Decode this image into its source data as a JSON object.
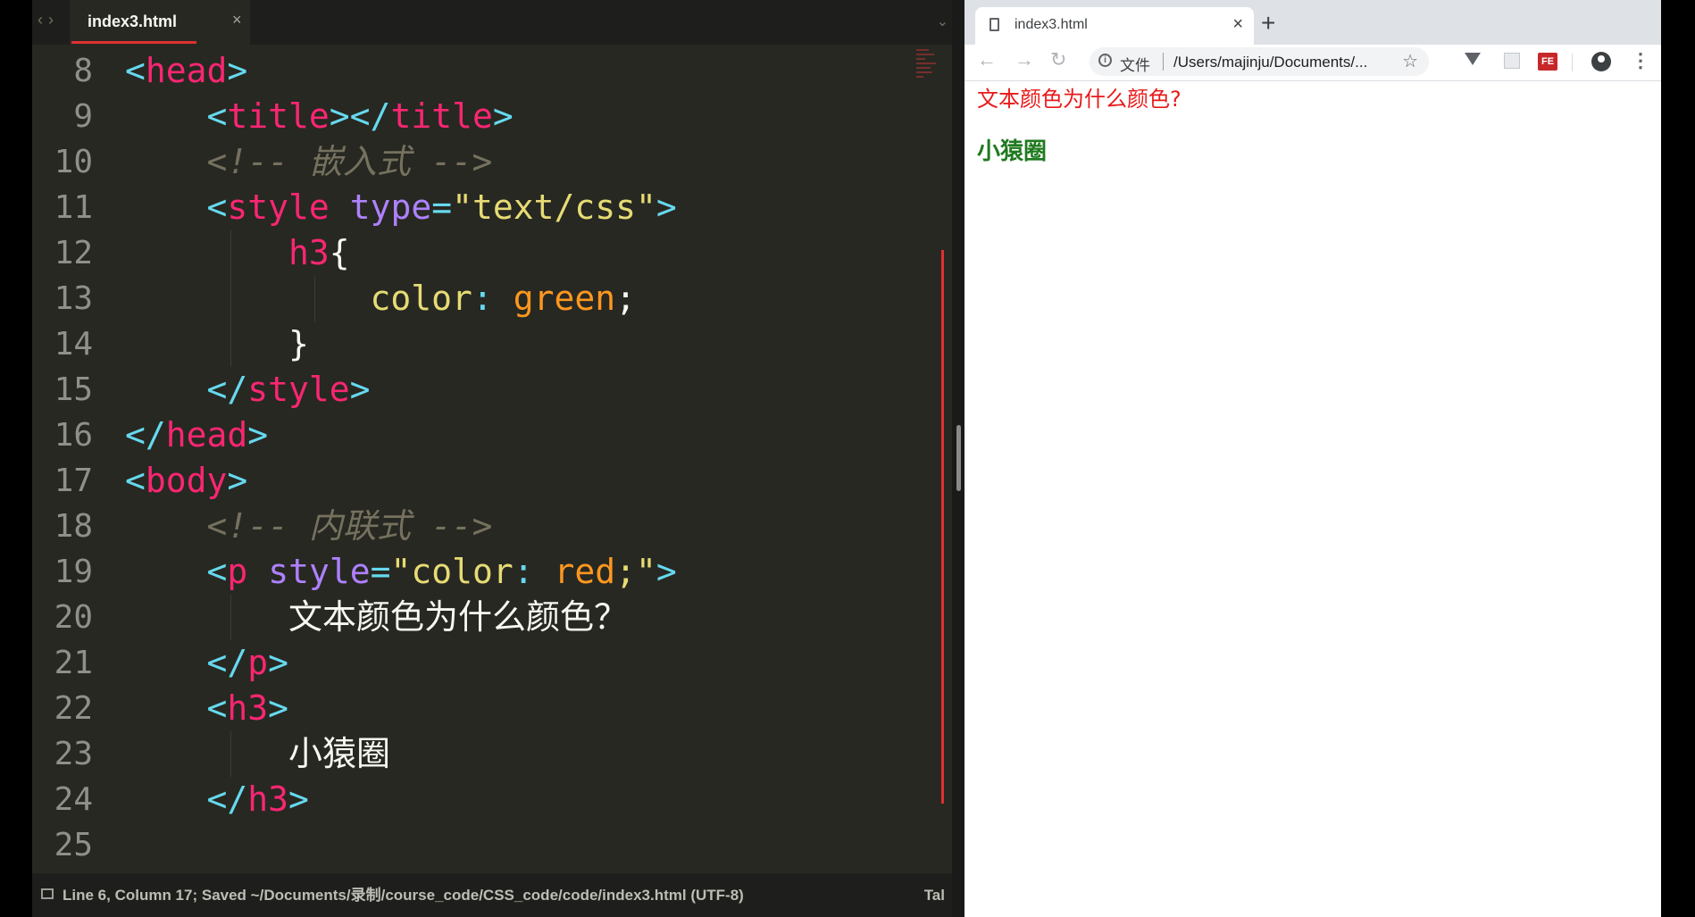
{
  "editor": {
    "tab_name": "index3.html",
    "tab_close": "×",
    "lines": [
      {
        "n": "8",
        "tokens": [
          {
            "c": "pun",
            "t": "<"
          },
          {
            "c": "tg",
            "t": "head"
          },
          {
            "c": "pun",
            "t": ">"
          }
        ]
      },
      {
        "n": "9",
        "tokens": [
          {
            "c": "pu",
            "t": "    "
          },
          {
            "c": "pun",
            "t": "<"
          },
          {
            "c": "tg",
            "t": "title"
          },
          {
            "c": "pun",
            "t": "></"
          },
          {
            "c": "tg",
            "t": "title"
          },
          {
            "c": "pun",
            "t": ">"
          }
        ]
      },
      {
        "n": "10",
        "tokens": [
          {
            "c": "pu",
            "t": "    "
          },
          {
            "c": "cm",
            "t": "<!-- 嵌入式 -->"
          }
        ]
      },
      {
        "n": "11",
        "tokens": [
          {
            "c": "pu",
            "t": "    "
          },
          {
            "c": "pun",
            "t": "<"
          },
          {
            "c": "tg",
            "t": "style"
          },
          {
            "c": "pu",
            "t": " "
          },
          {
            "c": "at",
            "t": "type"
          },
          {
            "c": "pun",
            "t": "="
          },
          {
            "c": "st",
            "t": "\"text/css\""
          },
          {
            "c": "pun",
            "t": ">"
          }
        ]
      },
      {
        "n": "12",
        "tokens": [
          {
            "c": "pu",
            "t": "        "
          },
          {
            "c": "tg",
            "t": "h3"
          },
          {
            "c": "pu",
            "t": "{"
          }
        ]
      },
      {
        "n": "13",
        "tokens": [
          {
            "c": "pu",
            "t": "            "
          },
          {
            "c": "pr",
            "t": "color"
          },
          {
            "c": "pun",
            "t": ": "
          },
          {
            "c": "vl",
            "t": "green"
          },
          {
            "c": "pu",
            "t": ";"
          }
        ]
      },
      {
        "n": "14",
        "tokens": [
          {
            "c": "pu",
            "t": "        "
          },
          {
            "c": "pu",
            "t": "}"
          }
        ]
      },
      {
        "n": "15",
        "tokens": [
          {
            "c": "pu",
            "t": "    "
          },
          {
            "c": "pun",
            "t": "</"
          },
          {
            "c": "tg",
            "t": "style"
          },
          {
            "c": "pun",
            "t": ">"
          }
        ]
      },
      {
        "n": "16",
        "tokens": [
          {
            "c": "pun",
            "t": "</"
          },
          {
            "c": "tg",
            "t": "head"
          },
          {
            "c": "pun",
            "t": ">"
          }
        ]
      },
      {
        "n": "17",
        "tokens": [
          {
            "c": "pun",
            "t": "<"
          },
          {
            "c": "tg",
            "t": "body"
          },
          {
            "c": "pun",
            "t": ">"
          }
        ]
      },
      {
        "n": "18",
        "tokens": [
          {
            "c": "pu",
            "t": "    "
          },
          {
            "c": "cm",
            "t": "<!-- 内联式 -->"
          }
        ]
      },
      {
        "n": "19",
        "tokens": [
          {
            "c": "pu",
            "t": "    "
          },
          {
            "c": "pun",
            "t": "<"
          },
          {
            "c": "tg",
            "t": "p"
          },
          {
            "c": "pu",
            "t": " "
          },
          {
            "c": "at",
            "t": "style"
          },
          {
            "c": "pun",
            "t": "="
          },
          {
            "c": "st",
            "t": "\"color"
          },
          {
            "c": "pun",
            "t": ": "
          },
          {
            "c": "vl",
            "t": "red"
          },
          {
            "c": "st",
            "t": ";\""
          },
          {
            "c": "pun",
            "t": ">"
          }
        ]
      },
      {
        "n": "20",
        "tokens": [
          {
            "c": "pu",
            "t": "        "
          },
          {
            "c": "tx",
            "t": "文本颜色为什么颜色？"
          }
        ]
      },
      {
        "n": "21",
        "tokens": [
          {
            "c": "pu",
            "t": "    "
          },
          {
            "c": "pun",
            "t": "</"
          },
          {
            "c": "tg",
            "t": "p"
          },
          {
            "c": "pun",
            "t": ">"
          }
        ]
      },
      {
        "n": "22",
        "tokens": [
          {
            "c": "pu",
            "t": "    "
          },
          {
            "c": "pun",
            "t": "<"
          },
          {
            "c": "tg",
            "t": "h3"
          },
          {
            "c": "pun",
            "t": ">"
          }
        ]
      },
      {
        "n": "23",
        "tokens": [
          {
            "c": "pu",
            "t": "        "
          },
          {
            "c": "tx",
            "t": "小猿圈"
          }
        ]
      },
      {
        "n": "24",
        "tokens": [
          {
            "c": "pu",
            "t": "    "
          },
          {
            "c": "pun",
            "t": "</"
          },
          {
            "c": "tg",
            "t": "h3"
          },
          {
            "c": "pun",
            "t": ">"
          }
        ]
      },
      {
        "n": "25",
        "tokens": []
      }
    ],
    "status_text": "Line 6, Column 17; Saved ~/Documents/录制/course_code/CSS_code/code/index3.html (UTF-8)",
    "status_right": "Tal"
  },
  "browser": {
    "tab_title": "index3.html",
    "tab_close": "×",
    "new_tab": "+",
    "back": "←",
    "forward": "→",
    "reload": "↻",
    "info": "i",
    "scheme": "文件",
    "url": "/Users/majinju/Documents/...",
    "star": "☆",
    "ext_fe": "FE",
    "menu": "⋮",
    "page_paragraph": "文本颜色为什么颜色?",
    "page_heading": "小猿圈"
  },
  "colors": {
    "paragraph_red": "#e81a1a",
    "heading_green": "#1f7a1f"
  }
}
